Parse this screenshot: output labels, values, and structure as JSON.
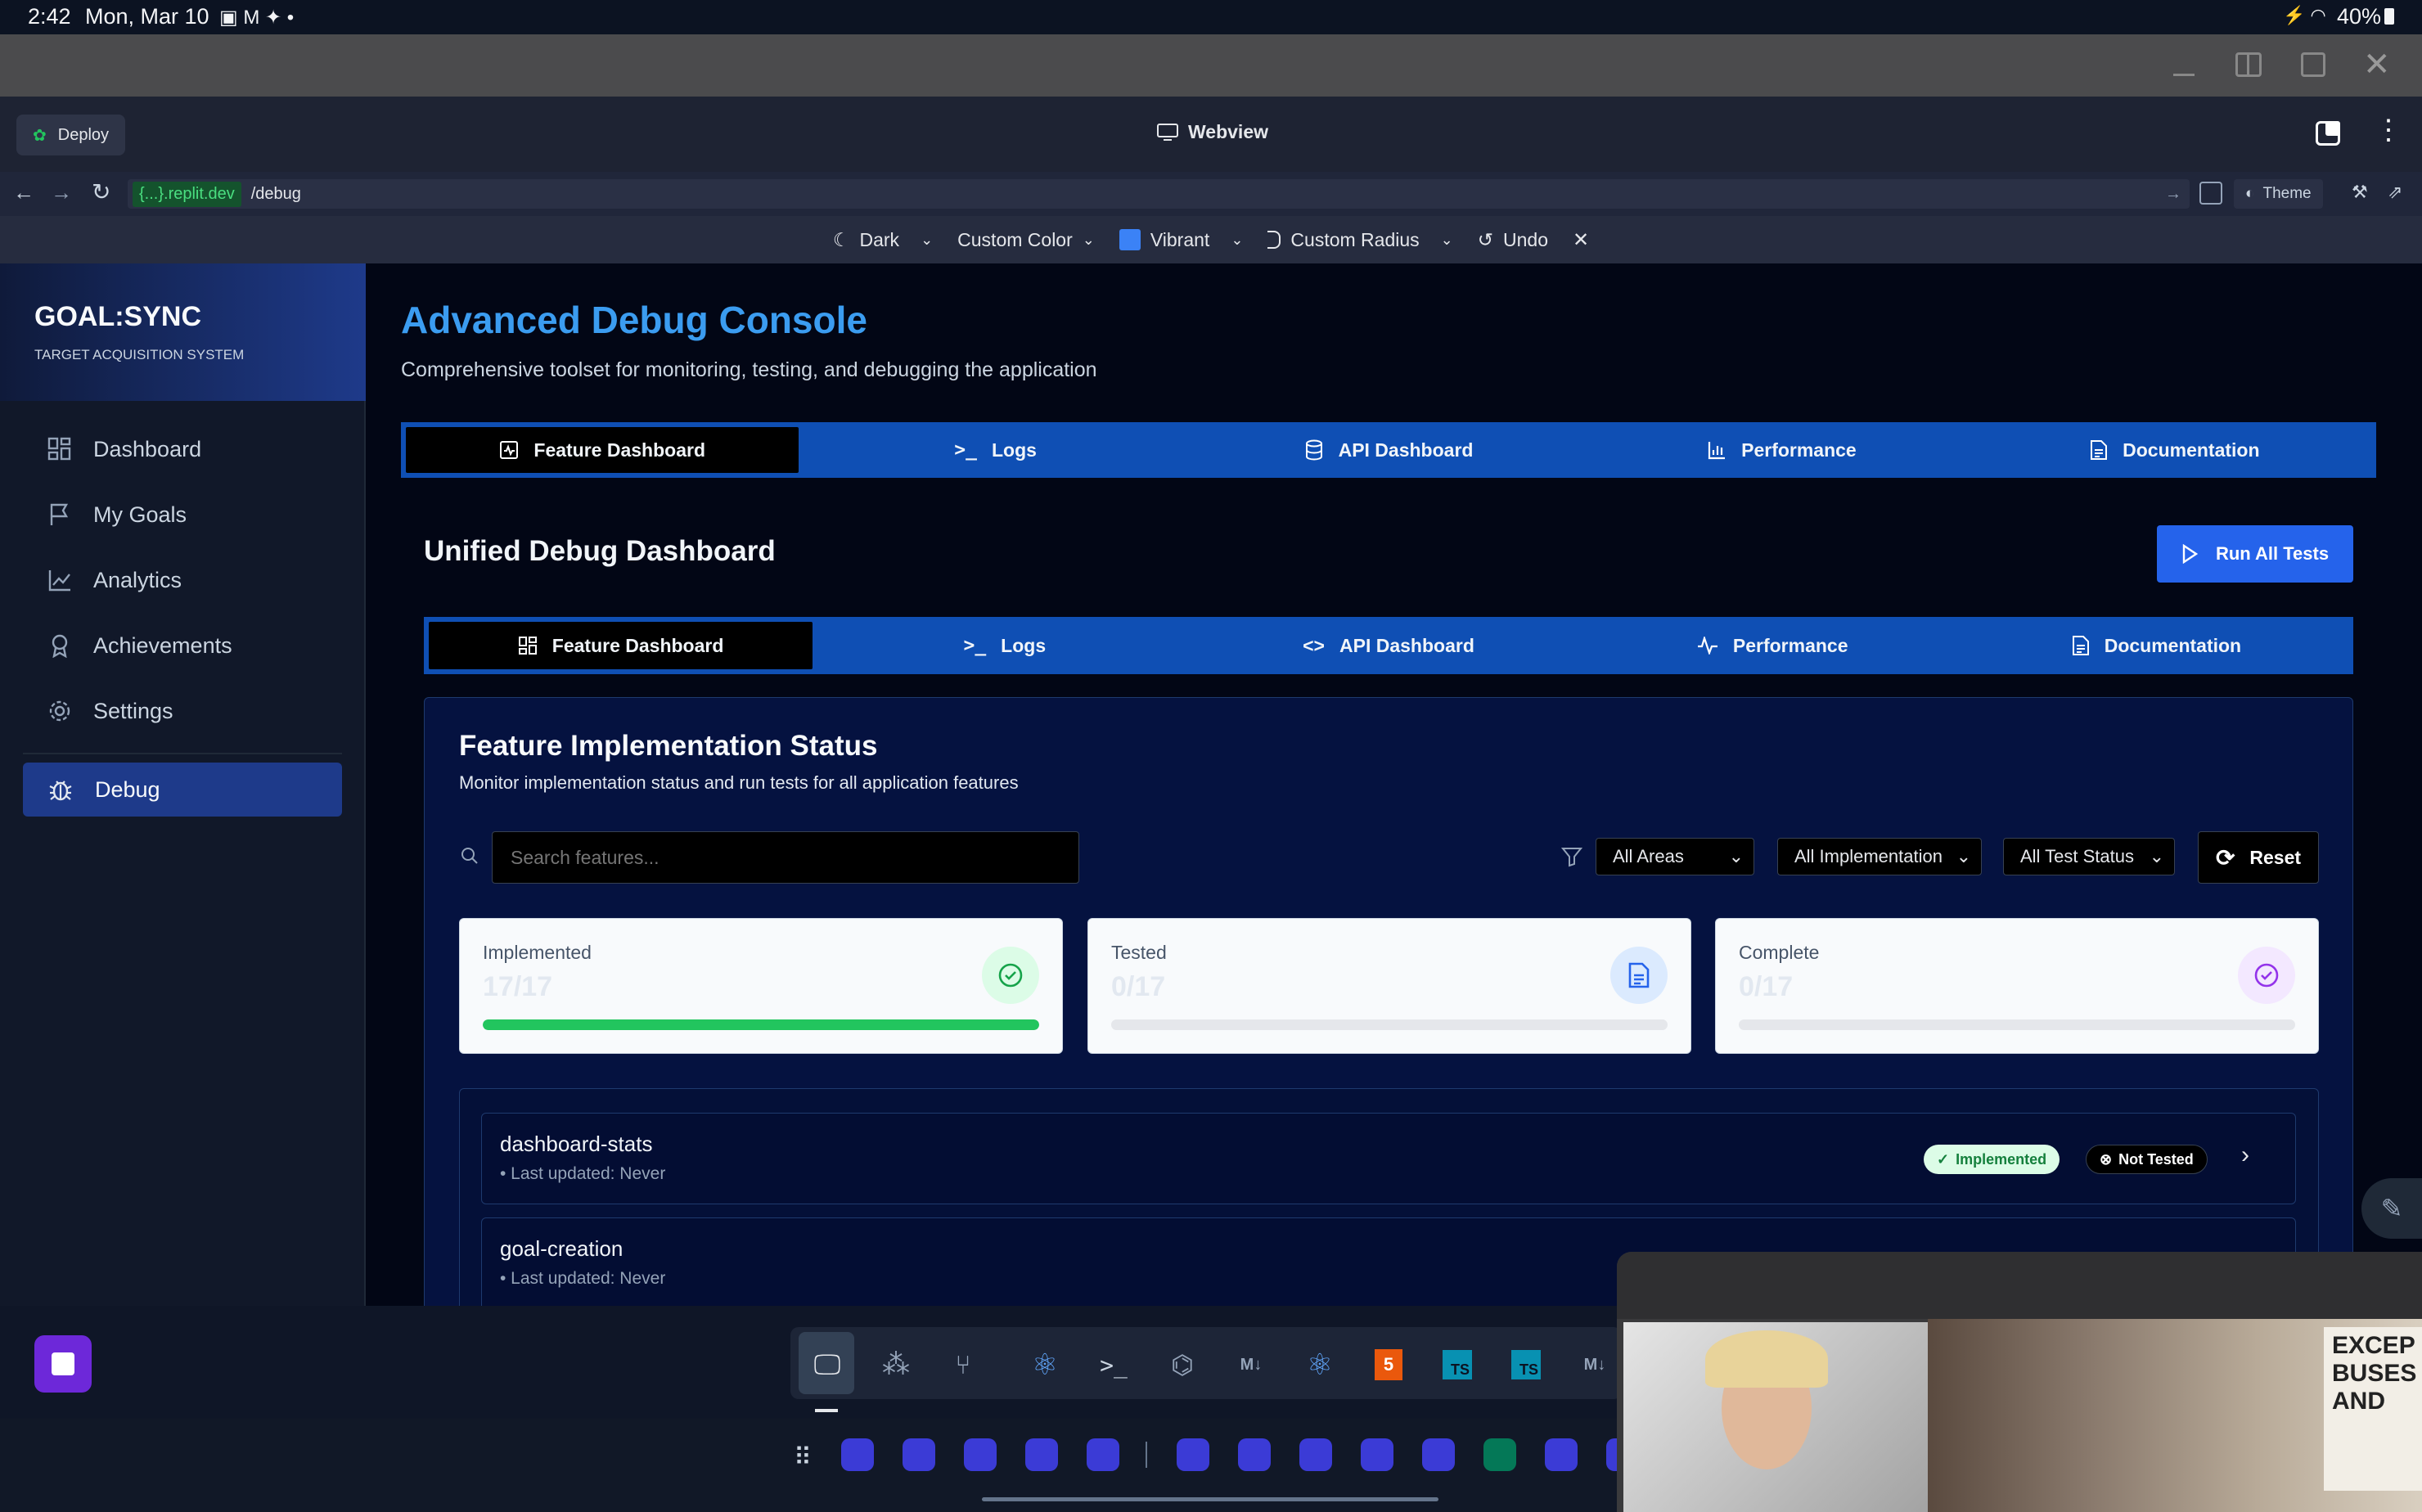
{
  "status_bar": {
    "time": "2:42",
    "date": "Mon, Mar 10",
    "battery": "40%"
  },
  "app_bar": {
    "deploy_label": "Deploy",
    "webview_label": "Webview"
  },
  "url_bar": {
    "domain": "{...}.replit.dev",
    "path": "/debug",
    "theme_label": "Theme"
  },
  "theme_bar": {
    "dark": "Dark",
    "custom_color": "Custom Color",
    "vibrant": "Vibrant",
    "custom_radius": "Custom Radius",
    "undo": "Undo"
  },
  "sidebar": {
    "brand_title": "GOAL:SYNC",
    "brand_subtitle": "TARGET ACQUISITION SYSTEM",
    "items": [
      {
        "label": "Dashboard",
        "icon": "dashboard-icon"
      },
      {
        "label": "My Goals",
        "icon": "flag-icon"
      },
      {
        "label": "Analytics",
        "icon": "chart-line-icon"
      },
      {
        "label": "Achievements",
        "icon": "award-icon"
      },
      {
        "label": "Settings",
        "icon": "gear-icon"
      },
      {
        "label": "Debug",
        "icon": "bug-icon",
        "active": true
      }
    ]
  },
  "page": {
    "title": "Advanced Debug Console",
    "subtitle": "Comprehensive toolset for monitoring, testing, and debugging the application",
    "top_tabs": [
      "Feature Dashboard",
      "Logs",
      "API Dashboard",
      "Performance",
      "Documentation"
    ],
    "section_title": "Unified Debug Dashboard",
    "run_all_label": "Run All Tests",
    "inner_tabs": [
      "Feature Dashboard",
      "Logs",
      "API Dashboard",
      "Performance",
      "Documentation"
    ]
  },
  "feature_panel": {
    "title": "Feature Implementation Status",
    "subtitle": "Monitor implementation status and run tests for all application features",
    "search_placeholder": "Search features...",
    "filters": {
      "areas": "All Areas",
      "implementation": "All Implementation",
      "test_status": "All Test Status",
      "reset": "Reset"
    },
    "stats": [
      {
        "label": "Implemented",
        "value": "17/17",
        "progress": 1.0,
        "color": "#22c55e"
      },
      {
        "label": "Tested",
        "value": "0/17",
        "progress": 0.0,
        "color": "#3b82f6"
      },
      {
        "label": "Complete",
        "value": "0/17",
        "progress": 0.0,
        "color": "#9333ea"
      }
    ],
    "features": [
      {
        "name": "dashboard-stats",
        "updated": "• Last updated: Never",
        "impl": "Implemented",
        "test": "Not Tested"
      },
      {
        "name": "goal-creation",
        "updated": "• Last updated: Never"
      }
    ]
  },
  "pip_sign": "EXCEP\nBUSES\nAND"
}
